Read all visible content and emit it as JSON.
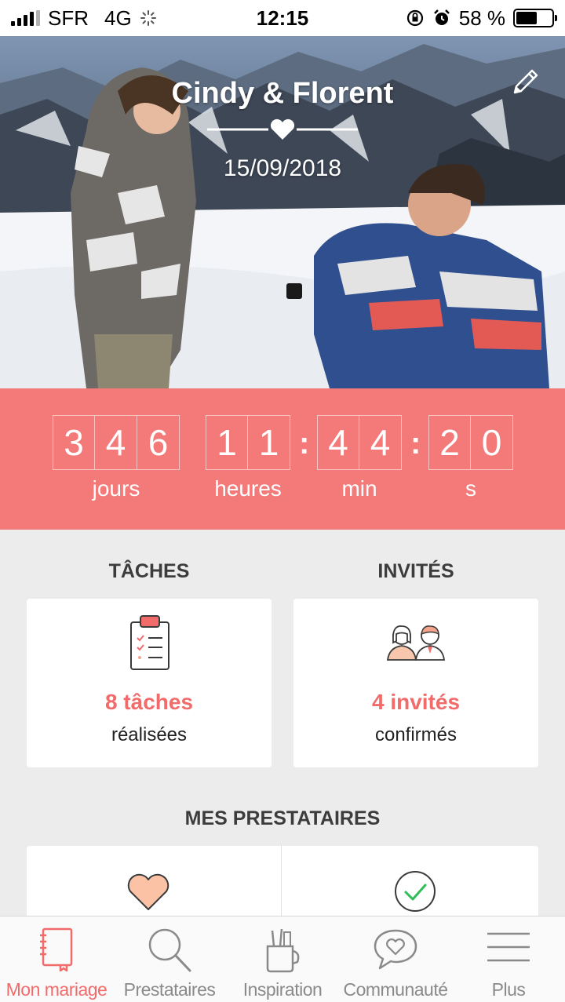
{
  "status_bar": {
    "carrier": "SFR",
    "network": "4G",
    "time": "12:15",
    "battery_percent_label": "58 %",
    "battery_level": 0.58
  },
  "hero": {
    "couple_names": "Cindy & Florent",
    "wedding_date": "15/09/2018"
  },
  "countdown": {
    "days": [
      "3",
      "4",
      "6"
    ],
    "hours": [
      "1",
      "1"
    ],
    "minutes": [
      "4",
      "4"
    ],
    "seconds": [
      "2",
      "0"
    ],
    "labels": {
      "days": "jours",
      "hours": "heures",
      "minutes": "min",
      "seconds": "s"
    }
  },
  "tasks": {
    "title": "TÂCHES",
    "count_label": "8 tâches",
    "sub_label": "réalisées"
  },
  "guests": {
    "title": "INVITÉS",
    "count_label": "4 invités",
    "sub_label": "confirmés"
  },
  "vendors": {
    "title": "MES PRESTATAIRES"
  },
  "tabbar": {
    "items": [
      {
        "label": "Mon mariage",
        "icon": "notebook-icon",
        "active": true
      },
      {
        "label": "Prestataires",
        "icon": "search-icon",
        "active": false
      },
      {
        "label": "Inspiration",
        "icon": "pencil-cup-icon",
        "active": false
      },
      {
        "label": "Communauté",
        "icon": "chat-heart-icon",
        "active": false
      },
      {
        "label": "Plus",
        "icon": "menu-icon",
        "active": false
      }
    ]
  },
  "colors": {
    "accent": "#f47a7a",
    "accent_text": "#f26b6b",
    "background": "#ececec"
  }
}
